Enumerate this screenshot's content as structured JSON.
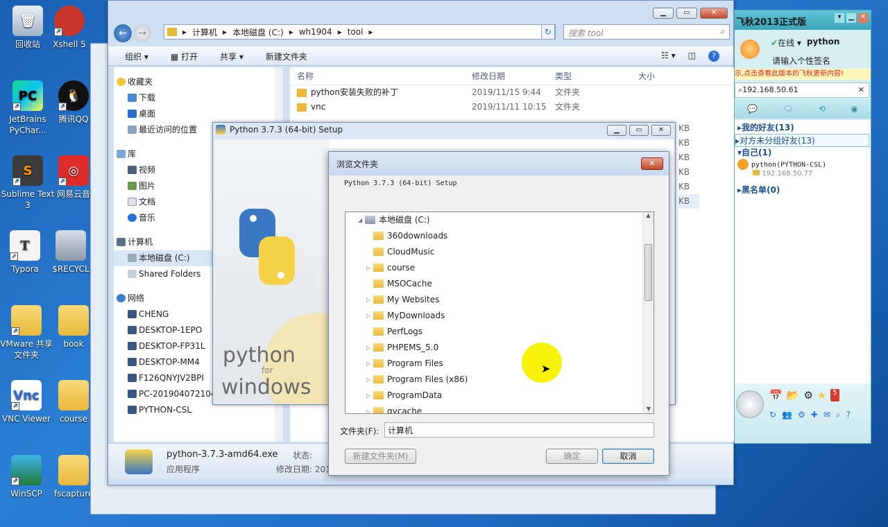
{
  "desktop": {
    "icons": [
      {
        "label": "回收站"
      },
      {
        "label": "Xshell 5"
      },
      {
        "label": "JetBrains PyChar..."
      },
      {
        "label": "腾讯QQ"
      },
      {
        "label": "Sublime Text 3"
      },
      {
        "label": "网易云音"
      },
      {
        "label": "Typora"
      },
      {
        "label": "$RECYCL"
      },
      {
        "label": "VMware 共享文件夹"
      },
      {
        "label": "book"
      },
      {
        "label": "VNC Viewer"
      },
      {
        "label": "course"
      },
      {
        "label": "WinSCP"
      },
      {
        "label": "fscapture"
      }
    ]
  },
  "explorer": {
    "path": [
      "计算机",
      "本地磁盘 (C:)",
      "wh1904",
      "tool"
    ],
    "search_placeholder": "搜索 tool",
    "toolbar": {
      "organize": "组织 ▾",
      "open": "打开",
      "share": "共享 ▾",
      "new_folder": "新建文件夹"
    },
    "nav": {
      "favorites": "收藏夹",
      "downloads": "下载",
      "desktop": "桌面",
      "recent": "最近访问的位置",
      "libraries": "库",
      "videos": "视频",
      "pictures": "图片",
      "documents": "文档",
      "music": "音乐",
      "computer": "计算机",
      "local_disk": "本地磁盘 (C:)",
      "shared": "Shared Folders",
      "network": "网络",
      "hosts": [
        "CHENG",
        "DESKTOP-1EPO",
        "DESKTOP-FP31L",
        "DESKTOP-MM4",
        "F126QNYJV2BPI",
        "PC-201904072104",
        "PYTHON-CSL"
      ]
    },
    "columns": {
      "name": "名称",
      "date": "修改日期",
      "type": "类型",
      "size": "大小"
    },
    "rows": [
      {
        "name": "python安装失败的补丁",
        "date": "2019/11/15 9:44",
        "type": "文件夹"
      },
      {
        "name": "vnc",
        "date": "2019/11/11 10:15",
        "type": "文件夹"
      }
    ],
    "size_units": [
      "KB",
      "KB",
      "KB",
      "KB",
      "KB",
      "KB"
    ],
    "status": {
      "filename": "python-3.7.3-amd64.exe",
      "filetype": "应用程序",
      "state_label": "状态:",
      "mdate_label": "修改日期: 201"
    }
  },
  "setup": {
    "title": "Python 3.7.3 (64-bit) Setup",
    "logo_line1": "python",
    "logo_line2": "for",
    "logo_line3": "windows"
  },
  "browse": {
    "title": "浏览文件夹",
    "subtitle": "Python 3.7.3 (64-bit) Setup",
    "root": "本地磁盘 (C:)",
    "folders": [
      {
        "name": "360downloads",
        "expandable": false
      },
      {
        "name": "CloudMusic",
        "expandable": false
      },
      {
        "name": "course",
        "expandable": true
      },
      {
        "name": "MSOCache",
        "expandable": false
      },
      {
        "name": "My Websites",
        "expandable": true
      },
      {
        "name": "MyDownloads",
        "expandable": true
      },
      {
        "name": "PerfLogs",
        "expandable": false
      },
      {
        "name": "PHPEMS_5.0",
        "expandable": true
      },
      {
        "name": "Program Files",
        "expandable": true
      },
      {
        "name": "Program Files (x86)",
        "expandable": true
      },
      {
        "name": "ProgramData",
        "expandable": true
      },
      {
        "name": "qycache",
        "expandable": true
      }
    ],
    "folder_label": "文件夹(F):",
    "folder_value": "计算机",
    "new_folder": "新建文件夹(M)",
    "ok": "确定",
    "cancel": "取消"
  },
  "qq": {
    "title": "飞秋2013正式版",
    "status": "在线",
    "username": "python",
    "signature": "请输入个性签名",
    "banner": "示,点击查看此版本的飞秋更新内容!",
    "search_value": "192.168.50.61",
    "groups": [
      {
        "label": "我的好友(13)"
      },
      {
        "label": "对方未分组好友(13)"
      },
      {
        "label": "自己(1)"
      },
      {
        "label": "黑名单(0)"
      }
    ],
    "self_name": "python(PYTHON-CSL)",
    "self_ip": "192.168.50.77",
    "badge": "5"
  },
  "colors": {
    "accent": "#1a5fb4",
    "folder": "#e9b93c",
    "qq_bg": "#d7eef2",
    "close_red": "#c74a2c"
  }
}
